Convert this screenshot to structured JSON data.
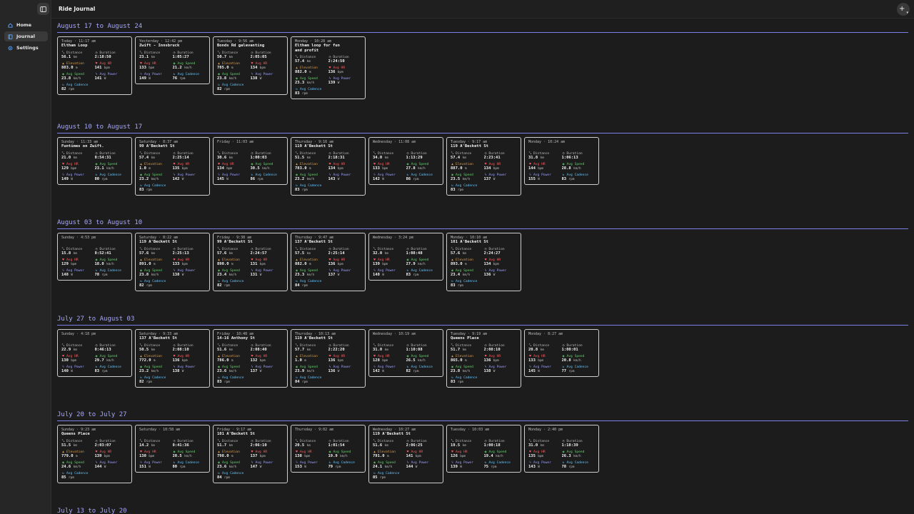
{
  "app": {
    "title": "Ride Journal",
    "add_label": "+",
    "nav": [
      {
        "label": "Home",
        "icon": "home-icon"
      },
      {
        "label": "Journal",
        "icon": "book-icon",
        "active": true
      },
      {
        "label": "Settings",
        "icon": "gear-icon"
      }
    ]
  },
  "labels": {
    "distance": "Distance",
    "duration": "Duration",
    "elevation": "Elevation",
    "avg_hr": "Avg HR",
    "avg_speed": "Avg Speed",
    "avg_power": "Avg Power",
    "avg_cadence": "Avg Cadence"
  },
  "units": {
    "km": "km",
    "m": "m",
    "bpm": "bpm",
    "kmh": "km/h",
    "w": "W",
    "rpm": "rpm"
  },
  "weeks": [
    {
      "title": "August 17 to August 24",
      "rides": [
        {
          "day": "Today · 11:17 am",
          "name": "Eltham Loop",
          "distance": "56.1",
          "duration": "2:18:50",
          "elevation": "883.0",
          "hr": "141",
          "speed": "23.8",
          "power": "141",
          "cadence": "82"
        },
        {
          "day": "Yesterday · 12:42 pm",
          "name": "Zwift - Innsbruck",
          "distance": "23.1",
          "duration": "1:05:27",
          "hr": "133",
          "speed": "21.2",
          "power": "149",
          "cadence": "76"
        },
        {
          "day": "Tuesday · 9:56 am",
          "name": "Bonds Rd galevanting",
          "distance": "50.7",
          "duration": "2:05:05",
          "elevation": "785.0",
          "hr": "134",
          "speed": "23.8",
          "power": "138",
          "cadence": "82"
        },
        {
          "day": "Monday · 10:28 am",
          "name": "Eltham loop for fun\nand profit",
          "distance": "57.4",
          "duration": "2:24:50",
          "elevation": "882.0",
          "hr": "136",
          "speed": "23.3",
          "power": "139",
          "cadence": "83"
        }
      ]
    },
    {
      "title": "August 10 to August 17",
      "rides": [
        {
          "day": "Sunday · 11:33 am",
          "name": "Funtimes on Zwift.",
          "distance": "21.0",
          "duration": "0:54:31",
          "hr": "129",
          "speed": "23.1",
          "power": "149",
          "cadence": "80"
        },
        {
          "day": "Saturday · 8:37 am",
          "name": "99 A'Beckett St",
          "distance": "57.4",
          "duration": "2:25:14",
          "elevation": "1.0",
          "hr": "135",
          "speed": "23.2",
          "power": "142",
          "cadence": "83"
        },
        {
          "day": "Friday · 11:03 am",
          "name": "",
          "distance": "30.6",
          "duration": "1:00:03",
          "hr": "134",
          "speed": "30.5",
          "power": "145",
          "cadence": "86"
        },
        {
          "day": "Thursday · 9:16 am",
          "name": "119 A'Beckett St",
          "distance": "51.5",
          "duration": "2:18:31",
          "elevation": "783.0",
          "hr": "134",
          "speed": "23.2",
          "power": "143",
          "cadence": "83"
        },
        {
          "day": "Wednesday · 11:08 am",
          "name": "",
          "distance": "34.0",
          "duration": "1:13:29",
          "hr": "133",
          "speed": "27.8",
          "power": "142",
          "cadence": "86"
        },
        {
          "day": "Tuesday · 9:17 am",
          "name": "119 A'Beckett St",
          "distance": "57.4",
          "duration": "2:23:41",
          "elevation": "887.0",
          "hr": "134",
          "speed": "23.5",
          "power": "137",
          "cadence": "83"
        },
        {
          "day": "Monday · 10:24 am",
          "name": "",
          "distance": "31.8",
          "duration": "1:06:13",
          "hr": "144",
          "speed": "28.8",
          "power": "155",
          "cadence": "83"
        }
      ]
    },
    {
      "title": "August 03 to August 10",
      "rides": [
        {
          "day": "Sunday · 4:53 pm",
          "name": "",
          "distance": "15.8",
          "duration": "0:52:41",
          "hr": "129",
          "speed": "18.0",
          "power": "148",
          "cadence": "78"
        },
        {
          "day": "Saturday · 8:22 am",
          "name": "119 A'Beckett St",
          "distance": "57.6",
          "duration": "2:25:13",
          "elevation": "891.0",
          "hr": "133",
          "speed": "23.8",
          "power": "138",
          "cadence": "82"
        },
        {
          "day": "Friday · 9:38 am",
          "name": "99 A'Beckett St",
          "distance": "57.6",
          "duration": "2:24:57",
          "elevation": "890.0",
          "hr": "131",
          "speed": "23.4",
          "power": "131",
          "cadence": "82"
        },
        {
          "day": "Thursday · 9:47 am",
          "name": "137 A'Beckett St",
          "distance": "57.5",
          "duration": "2:25:14",
          "elevation": "882.0",
          "hr": "136",
          "speed": "23.3",
          "power": "137",
          "cadence": "84"
        },
        {
          "day": "Wednesday · 3:24 pm",
          "name": "",
          "distance": "32.0",
          "duration": "1:08:48",
          "hr": "139",
          "speed": "27.9",
          "power": "148",
          "cadence": "83"
        },
        {
          "day": "Monday · 10:10 am",
          "name": "101 A'Beckett St",
          "distance": "57.6",
          "duration": "2:24:27",
          "elevation": "893.0",
          "hr": "134",
          "speed": "23.4",
          "power": "136",
          "cadence": "83"
        }
      ]
    },
    {
      "title": "July 27 to August 03",
      "rides": [
        {
          "day": "Sunday · 4:18 pm",
          "name": "",
          "distance": "22.9",
          "duration": "0:46:13",
          "hr": "130",
          "speed": "29.7",
          "power": "140",
          "cadence": "83"
        },
        {
          "day": "Saturday · 9:33 am",
          "name": "137 A'Beckett St",
          "distance": "50.5",
          "duration": "2:08:10",
          "elevation": "772.0",
          "hr": "136",
          "speed": "23.2",
          "power": "138",
          "cadence": "82"
        },
        {
          "day": "Friday · 10:48 am",
          "name": "14-16 Anthony St",
          "distance": "51.6",
          "duration": "2:08:40",
          "elevation": "786.0",
          "hr": "132",
          "speed": "23.6",
          "power": "137",
          "cadence": "83"
        },
        {
          "day": "Thursday · 10:13 am",
          "name": "119 A'Beckett St",
          "distance": "57.7",
          "duration": "2:22:20",
          "elevation": "1.0",
          "hr": "136",
          "speed": "23.9",
          "power": "136",
          "cadence": "84"
        },
        {
          "day": "Wednesday · 10:19 am",
          "name": "",
          "distance": "31.0",
          "duration": "1:10:08",
          "hr": "128",
          "speed": "26.5",
          "power": "142",
          "cadence": "82"
        },
        {
          "day": "Tuesday · 9:19 am",
          "name": "Queens Place",
          "distance": "51.7",
          "duration": "2:08:10",
          "elevation": "865.0",
          "hr": "136",
          "speed": "23.8",
          "power": "138",
          "cadence": "83"
        },
        {
          "day": "Monday · 8:27 am",
          "name": "",
          "distance": "20.8",
          "duration": "1:00:01",
          "hr": "133",
          "speed": "20.8",
          "power": "145",
          "cadence": "77"
        }
      ]
    },
    {
      "title": "July 20 to July 27",
      "rides": [
        {
          "day": "Sunday · 9:23 am",
          "name": "Queens Place",
          "distance": "51.5",
          "duration": "2:03:07",
          "elevation": "779.0",
          "hr": "139",
          "speed": "24.6",
          "power": "144",
          "cadence": "85"
        },
        {
          "day": "Saturday · 10:58 am",
          "name": "",
          "distance": "14.2",
          "duration": "0:41:36",
          "hr": "130",
          "speed": "20.5",
          "power": "151",
          "cadence": "80"
        },
        {
          "day": "Friday · 9:17 am",
          "name": "101 A'Beckett St",
          "distance": "51.7",
          "duration": "2:06:10",
          "elevation": "798.0",
          "hr": "137",
          "speed": "23.6",
          "power": "147",
          "cadence": "84"
        },
        {
          "day": "Thursday · 9:02 am",
          "name": "",
          "distance": "20.5",
          "duration": "1:01:54",
          "hr": "138",
          "speed": "19.9",
          "power": "153",
          "cadence": "79"
        },
        {
          "day": "Wednesday · 10:27 am",
          "name": "119 A'Beckett St",
          "distance": "51.6",
          "duration": "2:06:25",
          "elevation": "791.0",
          "hr": "141",
          "speed": "24.1",
          "power": "144",
          "cadence": "85"
        },
        {
          "day": "Tuesday · 10:03 am",
          "name": "",
          "distance": "19.5",
          "duration": "1:00:18",
          "hr": "126",
          "speed": "19.4",
          "power": "139",
          "cadence": "75"
        },
        {
          "day": "Monday · 2:40 pm",
          "name": "",
          "distance": "31.0",
          "duration": "1:18:39",
          "hr": "135",
          "speed": "26.3",
          "power": "143",
          "cadence": "78"
        }
      ]
    },
    {
      "title": "July 13 to July 20",
      "rides": []
    }
  ]
}
